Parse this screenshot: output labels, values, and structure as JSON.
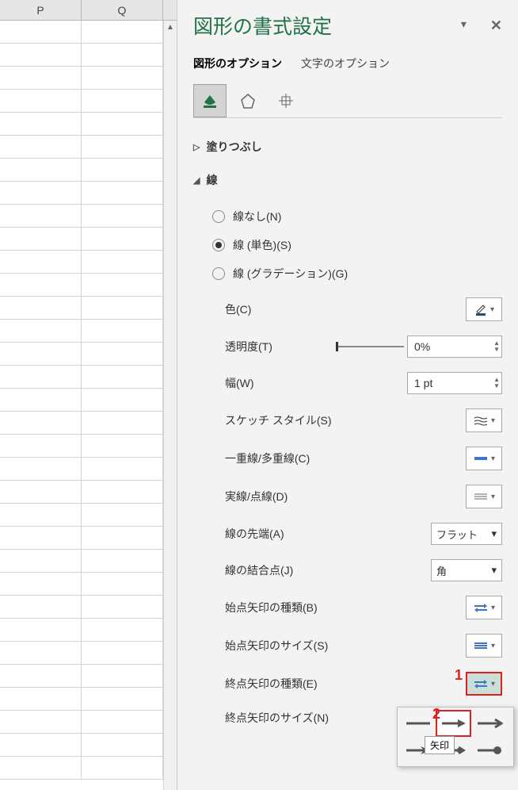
{
  "columns": [
    "P",
    "Q"
  ],
  "panel": {
    "title": "図形の書式設定",
    "tab_shape": "図形のオプション",
    "tab_text": "文字のオプション"
  },
  "sections": {
    "fill": "塗りつぶし",
    "line": "線"
  },
  "line_options": {
    "none": "線なし(N)",
    "solid": "線 (単色)(S)",
    "gradient": "線 (グラデーション)(G)"
  },
  "props": {
    "color": "色(C)",
    "transparency": "透明度(T)",
    "transparency_val": "0%",
    "width": "幅(W)",
    "width_val": "1 pt",
    "sketch": "スケッチ スタイル(S)",
    "compound": "一重線/多重線(C)",
    "dash": "実線/点線(D)",
    "cap": "線の先端(A)",
    "cap_val": "フラット",
    "join": "線の結合点(J)",
    "join_val": "角",
    "begin_type": "始点矢印の種類(B)",
    "begin_size": "始点矢印のサイズ(S)",
    "end_type": "終点矢印の種類(E)",
    "end_size": "終点矢印のサイズ(N)"
  },
  "tooltip": "矢印",
  "labels": {
    "n1": "1",
    "n2": "2"
  }
}
